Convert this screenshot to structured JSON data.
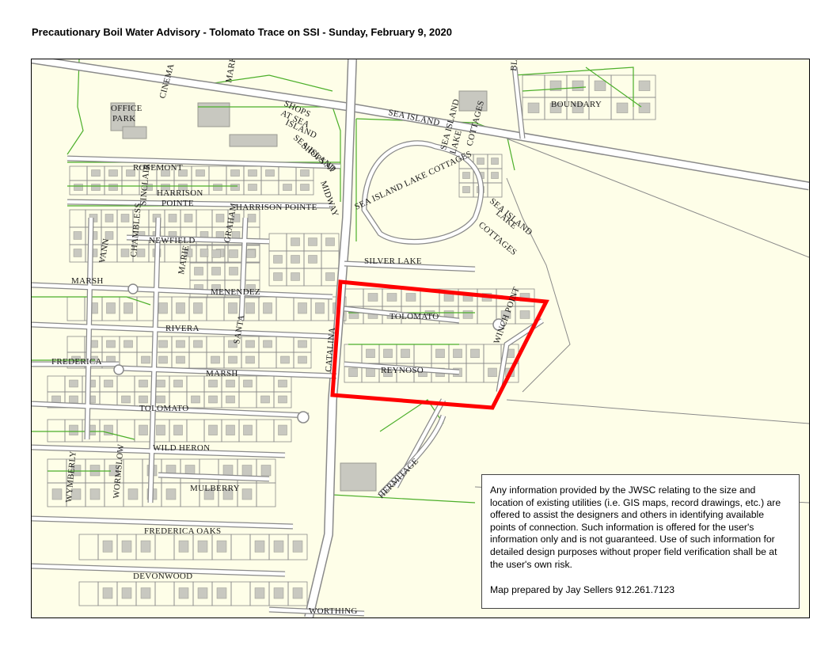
{
  "title": "Precautionary Boil Water Advisory - Tolomato Trace on SSI - Sunday, February 9, 2020",
  "colors": {
    "land": "#fefee8",
    "parcel_line": "#8a8a8a",
    "green_line": "#4caf2a",
    "building": "#c8c8c0",
    "road_fill": "#ffffff",
    "advisory_outline": "#ff0000"
  },
  "advisory_area": {
    "name": "Tolomato Trace",
    "outline_color": "#ff0000"
  },
  "street_labels": [
    "OFFICE",
    "PARK",
    "CINEMA",
    "MARKET",
    "SHOPS",
    "AT SEA",
    "ISLAND",
    "SHOPS AT",
    "SEA ISLAND",
    "SEA ISLAND",
    "BLACKBANKS",
    "BOUNDARY",
    "SEA ISLAND",
    "LAKE",
    "COTTAGES",
    "SEA ISLAND LAKE COTTAGES",
    "SEA ISLAND",
    "LAKE",
    "COTTAGES",
    "ROSEMONT",
    "HARRISON",
    "POINTE",
    "HARRISON POINTE",
    "CHAMBLESS",
    "SINCLAIR",
    "GRAHAM",
    "MIDWAY",
    "NEWFIELD",
    "VANN",
    "MARIE",
    "SILVER LAKE",
    "MARSH",
    "MENENDEZ",
    "TOLOMATO",
    "WINCH POINT",
    "RIVERA",
    "SANTA",
    "CATALINA",
    "FREDERICA",
    "MARSH",
    "REYNOSO",
    "TOLOMATO",
    "WILD HERON",
    "WYMBERLY",
    "WORMSLOW",
    "MULBERRY",
    "HERMITAGE",
    "FREDERICA OAKS",
    "DEVONWOOD",
    "WORTHING",
    "ADAMS"
  ],
  "disclaimer": {
    "text": "Any information provided by the JWSC relating to the size and location of existing utilities (i.e. GIS maps, record drawings, etc.) are offered to assist the designers and others in identifying available points of connection. Such information is offered for the user's information only and is not guaranteed. Use of such information for detailed design purposes without proper field verification shall be at the user's own risk.",
    "credit": "Map prepared by Jay Sellers 912.261.7123"
  }
}
